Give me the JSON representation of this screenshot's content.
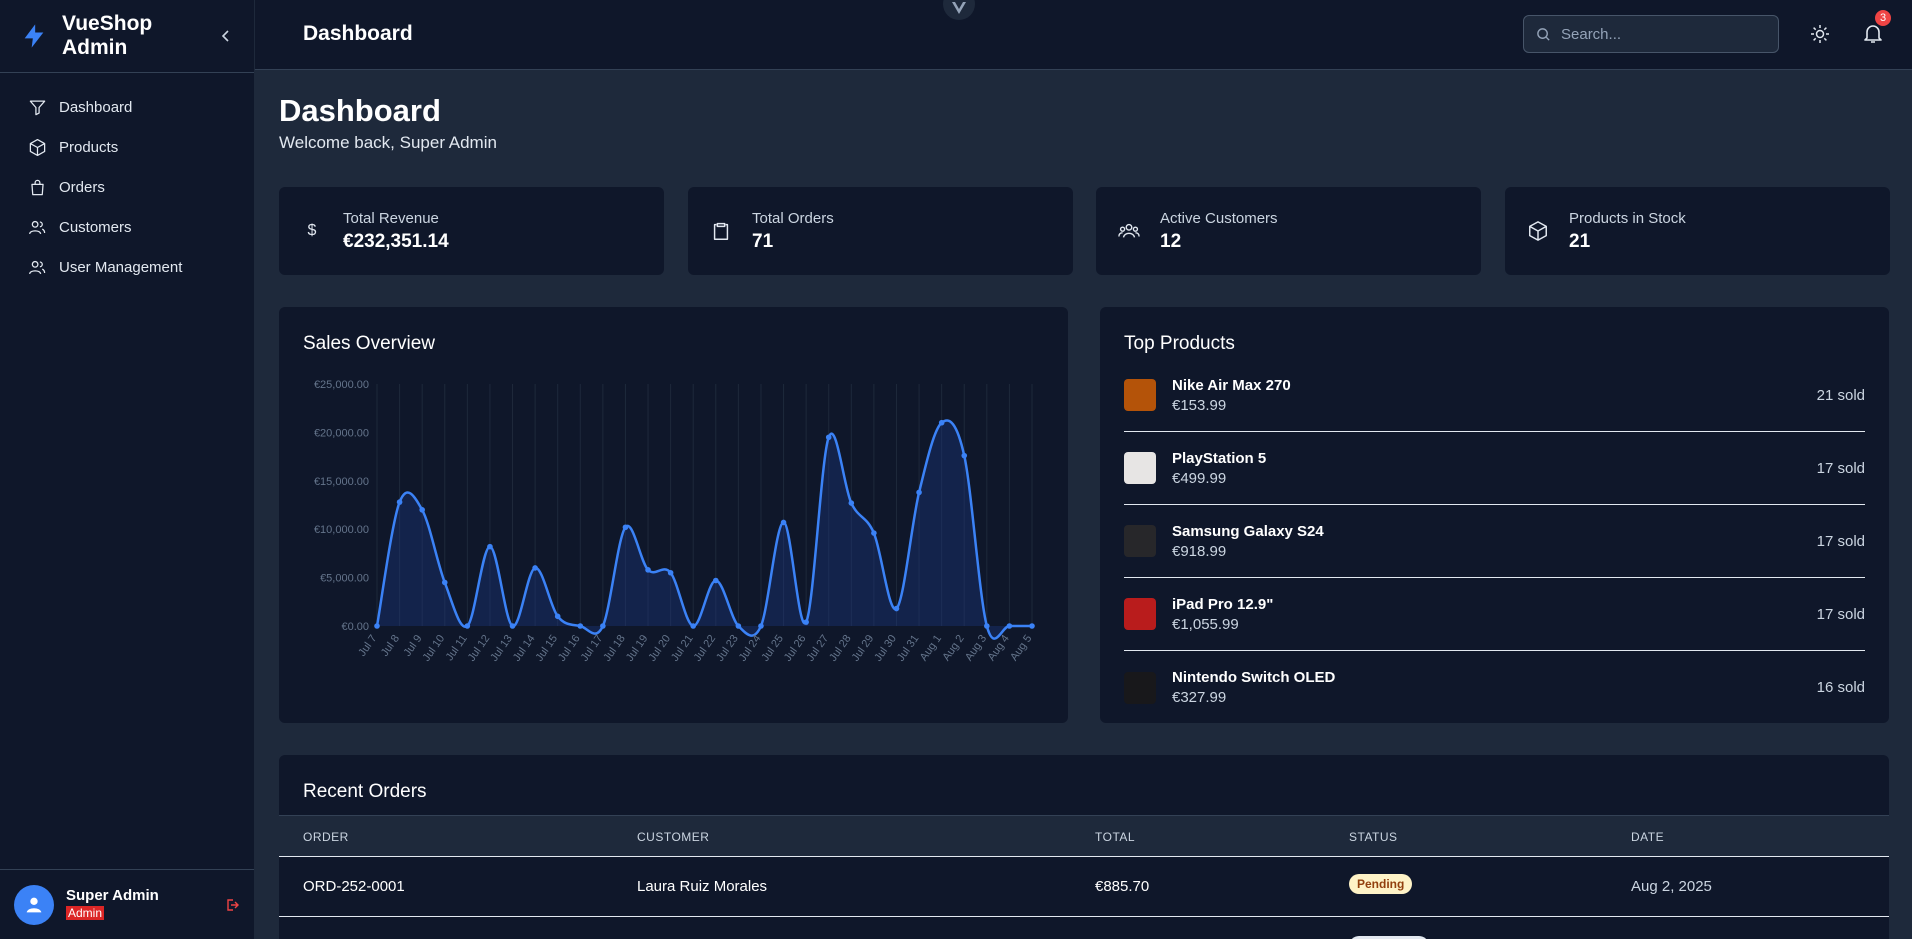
{
  "brand": {
    "title": "VueShop Admin"
  },
  "sidebar": {
    "items": [
      {
        "label": "Dashboard",
        "icon": "filter-icon"
      },
      {
        "label": "Products",
        "icon": "cube-icon"
      },
      {
        "label": "Orders",
        "icon": "shopping-bag-icon"
      },
      {
        "label": "Customers",
        "icon": "user-group-icon"
      },
      {
        "label": "User Management",
        "icon": "user-group-icon"
      }
    ],
    "user": {
      "name": "Super Admin",
      "role": "Admin"
    }
  },
  "topbar": {
    "title": "Dashboard",
    "search_placeholder": "Search...",
    "notification_count": "3"
  },
  "page": {
    "title": "Dashboard",
    "subtitle": "Welcome back, Super Admin"
  },
  "stats": [
    {
      "label": "Total Revenue",
      "value": "€232,351.14",
      "icon": "dollar-icon"
    },
    {
      "label": "Total Orders",
      "value": "71",
      "icon": "clipboard-icon"
    },
    {
      "label": "Active Customers",
      "value": "12",
      "icon": "users-icon"
    },
    {
      "label": "Products in Stock",
      "value": "21",
      "icon": "cube-icon"
    }
  ],
  "sales": {
    "title": "Sales Overview"
  },
  "chart_data": {
    "type": "area",
    "title": "Sales Overview",
    "x": [
      "Jul 7",
      "Jul 8",
      "Jul 9",
      "Jul 10",
      "Jul 11",
      "Jul 12",
      "Jul 13",
      "Jul 14",
      "Jul 15",
      "Jul 16",
      "Jul 17",
      "Jul 18",
      "Jul 19",
      "Jul 20",
      "Jul 21",
      "Jul 22",
      "Jul 23",
      "Jul 24",
      "Jul 25",
      "Jul 26",
      "Jul 27",
      "Jul 28",
      "Jul 29",
      "Jul 30",
      "Jul 31",
      "Aug 1",
      "Aug 2",
      "Aug 3",
      "Aug 4",
      "Aug 5"
    ],
    "y_ticks": [
      "€0.00",
      "€5,000.00",
      "€10,000.00",
      "€15,000.00",
      "€20,000.00",
      "€25,000.00"
    ],
    "ylim": [
      0,
      25000
    ],
    "series": [
      {
        "values": [
          0,
          12800,
          12000,
          4500,
          0,
          8200,
          0,
          6000,
          1000,
          0,
          0,
          10200,
          5800,
          5500,
          0,
          4700,
          0,
          0,
          10700,
          400,
          19500,
          12700,
          9600,
          1800,
          13800,
          21000,
          17600,
          0,
          0,
          0
        ]
      }
    ],
    "color": "#3b82f6"
  },
  "top_products": {
    "title": "Top Products",
    "items": [
      {
        "name": "Nike Air Max 270",
        "price": "€153.99",
        "sold": "21 sold",
        "thumb": "#b45309"
      },
      {
        "name": "PlayStation 5",
        "price": "€499.99",
        "sold": "17 sold",
        "thumb": "#e7e5e4"
      },
      {
        "name": "Samsung Galaxy S24",
        "price": "€918.99",
        "sold": "17 sold",
        "thumb": "#27272a"
      },
      {
        "name": "iPad Pro 12.9\"",
        "price": "€1,055.99",
        "sold": "17 sold",
        "thumb": "#b91c1c"
      },
      {
        "name": "Nintendo Switch OLED",
        "price": "€327.99",
        "sold": "16 sold",
        "thumb": "#18181b"
      }
    ]
  },
  "recent_orders": {
    "title": "Recent Orders",
    "columns": [
      "ORDER",
      "CUSTOMER",
      "TOTAL",
      "STATUS",
      "DATE"
    ],
    "rows": [
      {
        "order": "ORD-252-0001",
        "customer": "Laura Ruiz Morales",
        "total": "€885.70",
        "status": "Pending",
        "date": "Aug 2, 2025"
      }
    ]
  }
}
